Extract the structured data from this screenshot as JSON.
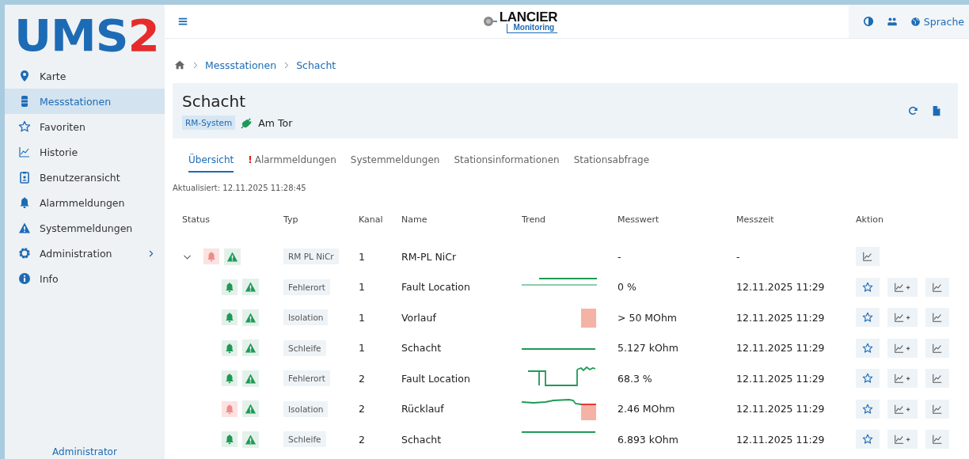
{
  "sidebar": {
    "logo": {
      "main": "UMS",
      "accent": "2"
    },
    "items": [
      {
        "kind": "pin",
        "label": "Karte",
        "selected": false
      },
      {
        "kind": "server",
        "label": "Messstationen",
        "selected": true
      },
      {
        "kind": "star",
        "label": "Favoriten",
        "selected": false
      },
      {
        "kind": "chart",
        "label": "Historie",
        "selected": false
      },
      {
        "kind": "badge",
        "label": "Benutzeransicht",
        "selected": false
      },
      {
        "kind": "bell",
        "label": "Alarmmeldungen",
        "selected": false
      },
      {
        "kind": "warning",
        "label": "Systemmeldungen",
        "selected": false
      },
      {
        "kind": "gear",
        "label": "Administration",
        "selected": false,
        "expandable": true
      },
      {
        "kind": "info",
        "label": "Info",
        "selected": false
      }
    ],
    "user": "Administrator"
  },
  "header": {
    "brand": {
      "name": "LANCIER",
      "sub": "Monitoring"
    },
    "language": "Sprache"
  },
  "breadcrumb": [
    "Messstationen",
    "Schacht"
  ],
  "station": {
    "title": "Schacht",
    "tag": "RM-System",
    "location": "Am Tor"
  },
  "tabs": [
    {
      "label": "Übersicht",
      "selected": true,
      "alert": false
    },
    {
      "label": "Alarmmeldungen",
      "selected": false,
      "alert": true,
      "alert_mark": "!"
    },
    {
      "label": "Systemmeldungen",
      "selected": false,
      "alert": false
    },
    {
      "label": "Stationsinformationen",
      "selected": false,
      "alert": false
    },
    {
      "label": "Stationsabfrage",
      "selected": false,
      "alert": false
    }
  ],
  "updated": "Aktualisiert: 12.11.2025 11:28:45",
  "table": {
    "columns": [
      "Status",
      "Typ",
      "Kanal",
      "Name",
      "Trend",
      "Messwert",
      "Messzeit",
      "Aktion"
    ],
    "rows": [
      {
        "expanded": true,
        "alarm": true,
        "type": "RM PL NiCr",
        "channel": "1",
        "name": "RM-PL NiCr",
        "value": "-",
        "time": "-",
        "actions": [
          {
            "kind": "chart"
          }
        ],
        "children": [
          {
            "alarm": false,
            "type": "Fehlerort",
            "channel": "1",
            "name": "Fault Location",
            "value": "0 %",
            "time": "12.11.2025 11:29",
            "trend_alarm": false,
            "actions": [
              {
                "kind": "favorite"
              },
              {
                "kind": "compare"
              },
              {
                "kind": "chart"
              }
            ]
          },
          {
            "alarm": false,
            "type": "Isolation",
            "channel": "1",
            "name": "Vorlauf",
            "value": "> 50 MOhm",
            "time": "12.11.2025 11:29",
            "trend_alarm": true,
            "actions": [
              {
                "kind": "favorite"
              },
              {
                "kind": "compare"
              },
              {
                "kind": "chart"
              }
            ]
          },
          {
            "alarm": false,
            "type": "Schleife",
            "channel": "1",
            "name": "Schacht",
            "value": "5.127 kOhm",
            "time": "12.11.2025 11:29",
            "trend_alarm": false,
            "actions": [
              {
                "kind": "favorite"
              },
              {
                "kind": "compare"
              },
              {
                "kind": "chart"
              }
            ]
          },
          {
            "alarm": false,
            "type": "Fehlerort",
            "channel": "2",
            "name": "Fault Location",
            "value": "68.3 %",
            "time": "12.11.2025 11:29",
            "trend_alarm": false,
            "actions": [
              {
                "kind": "favorite"
              },
              {
                "kind": "compare"
              },
              {
                "kind": "chart"
              }
            ]
          },
          {
            "alarm": true,
            "type": "Isolation",
            "channel": "2",
            "name": "Rücklauf",
            "value": "2.46 MOhm",
            "time": "12.11.2025 11:29",
            "trend_alarm": true,
            "actions": [
              {
                "kind": "favorite"
              },
              {
                "kind": "compare"
              },
              {
                "kind": "chart"
              }
            ]
          },
          {
            "alarm": false,
            "type": "Schleife",
            "channel": "2",
            "name": "Schacht",
            "value": "6.893 kOhm",
            "time": "12.11.2025 11:29",
            "trend_alarm": false,
            "actions": [
              {
                "kind": "favorite"
              },
              {
                "kind": "compare"
              },
              {
                "kind": "chart"
              }
            ]
          }
        ]
      }
    ]
  }
}
